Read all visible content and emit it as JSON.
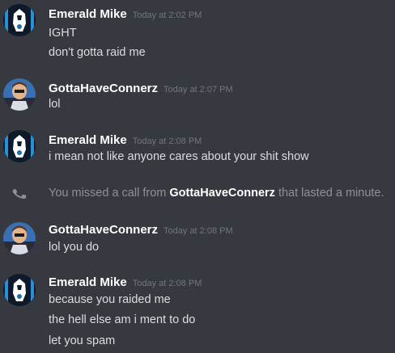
{
  "messages": [
    {
      "author": "Emerald Mike",
      "timestamp": "Today at 2:02 PM",
      "lines": [
        "IGHT",
        "don't gotta raid me"
      ],
      "avatar": "emerald-mike-avatar"
    },
    {
      "author": "GottaHaveConnerz",
      "timestamp": "Today at 2:07 PM",
      "lines": [
        "lol"
      ],
      "avatar": "gottahaveconnerz-avatar"
    },
    {
      "author": "Emerald Mike",
      "timestamp": "Today at 2:08 PM",
      "lines": [
        "i mean not like anyone cares about your shit show"
      ],
      "avatar": "emerald-mike-avatar"
    },
    {
      "author": "GottaHaveConnerz",
      "timestamp": "Today at 2:08 PM",
      "lines": [
        "lol you do"
      ],
      "avatar": "gottahaveconnerz-avatar"
    },
    {
      "author": "Emerald Mike",
      "timestamp": "Today at 2:08 PM",
      "lines": [
        "because you raided me",
        "the hell else am i ment to do",
        "let you spam"
      ],
      "avatar": "emerald-mike-avatar"
    }
  ],
  "missed_call": {
    "prefix": "You missed a call from",
    "caller": "GottaHaveConnerz",
    "suffix": "that lasted a minute.",
    "icon": "phone-icon"
  },
  "colors": {
    "background": "#36393f",
    "author": "#ffffff",
    "text": "#dcddde",
    "timestamp": "#72767d",
    "system_text": "#8e9297"
  }
}
